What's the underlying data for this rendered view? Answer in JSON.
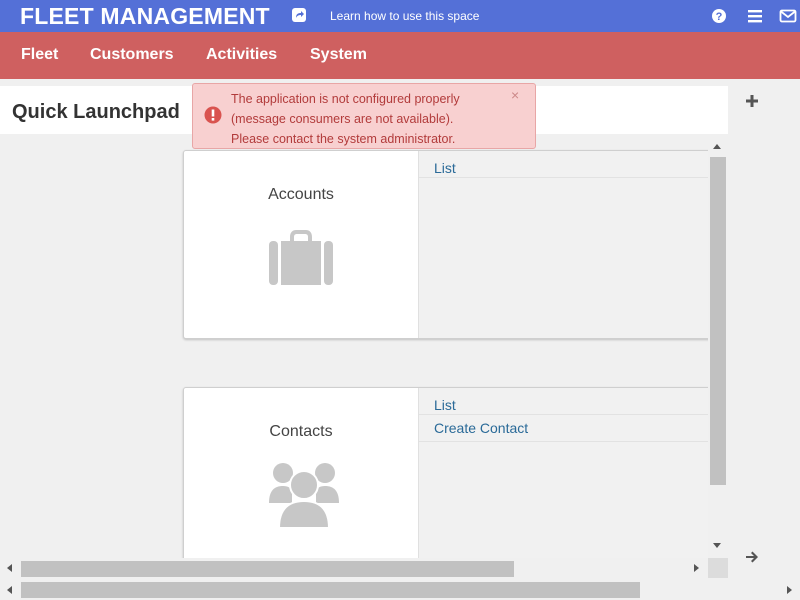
{
  "header": {
    "app_title": "FLEET MANAGEMENT",
    "learn_link": "Learn how to use this space",
    "accent_color": "#5470d7"
  },
  "nav": {
    "color": "#cf6060",
    "items": [
      {
        "label": "Fleet"
      },
      {
        "label": "Customers"
      },
      {
        "label": "Activities"
      },
      {
        "label": "System"
      }
    ]
  },
  "page": {
    "title": "Quick Launchpad"
  },
  "alert": {
    "lines": [
      "The application is not configured properly",
      "(message consumers are not available).",
      "Please contact the system administrator."
    ],
    "close_glyph": "×",
    "color": "#b23b3b"
  },
  "cards": [
    {
      "name": "Accounts",
      "icon": "briefcase-icon",
      "links": [
        "List"
      ]
    },
    {
      "name": "Contacts",
      "icon": "users-icon",
      "links": [
        "List",
        "Create Contact"
      ]
    }
  ]
}
